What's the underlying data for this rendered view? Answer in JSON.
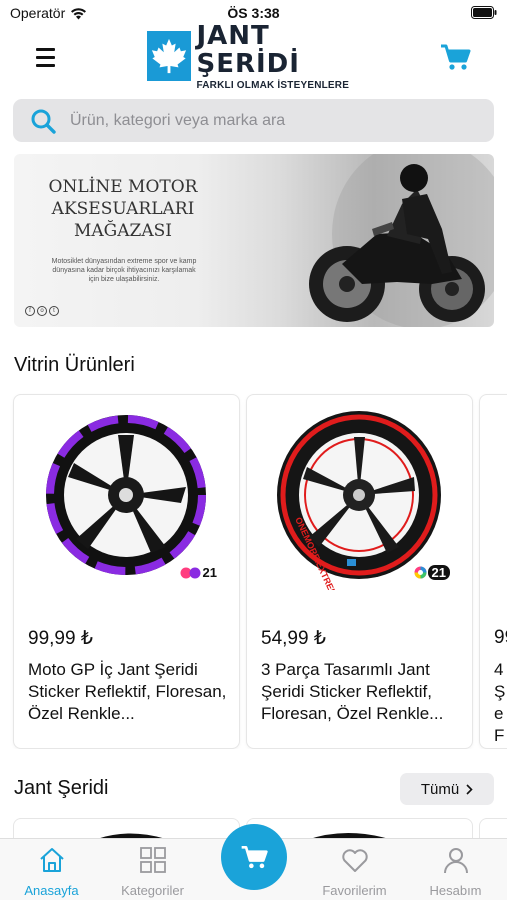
{
  "status_bar": {
    "carrier": "Operatör",
    "time": "ÖS 3:38"
  },
  "header": {
    "logo_title": "JANT ŞERİDİ",
    "logo_subtitle": "FARKLI OLMAK İSTEYENLERE"
  },
  "search": {
    "placeholder": "Ürün, kategori veya marka ara"
  },
  "banner": {
    "title": "ONLİNE MOTOR AKSESUARLARI MAĞAZASI",
    "description": "Motosiklet dünyasından extreme spor ve kamp dünyasına kadar birçok ihtiyacınızı karşılamak için bize ulaşabilirsiniz."
  },
  "showcase": {
    "title": "Vitrin Ürünleri",
    "products": [
      {
        "price": "99,99 ₺",
        "name": "Moto GP İç Jant Şeridi Sticker Reflektif, Floresan, Özel Renkle...",
        "badge": "21",
        "color": "#8a2be2"
      },
      {
        "price": "54,99 ₺",
        "name": "3 Parça Tasarımlı Jant Şeridi Sticker Reflektif, Floresan, Özel Renkle...",
        "badge": "21",
        "color": "#e01c1c",
        "rim_text": "ONEMORE.EXTREME"
      },
      {
        "price": "99",
        "name": "4 Şe Fl"
      }
    ]
  },
  "rim_strip": {
    "title": "Jant Şeridi",
    "all_label": "Tümü"
  },
  "tab_bar": {
    "tabs": [
      {
        "label": "Anasayfa",
        "icon": "home-icon",
        "active": true
      },
      {
        "label": "Kategoriler",
        "icon": "grid-icon",
        "active": false
      },
      {
        "label": "Favorilerim",
        "icon": "heart-icon",
        "active": false
      },
      {
        "label": "Hesabım",
        "icon": "user-icon",
        "active": false
      }
    ]
  },
  "colors": {
    "accent": "#1aa3d9",
    "logo_blue": "#1a9ad6"
  }
}
